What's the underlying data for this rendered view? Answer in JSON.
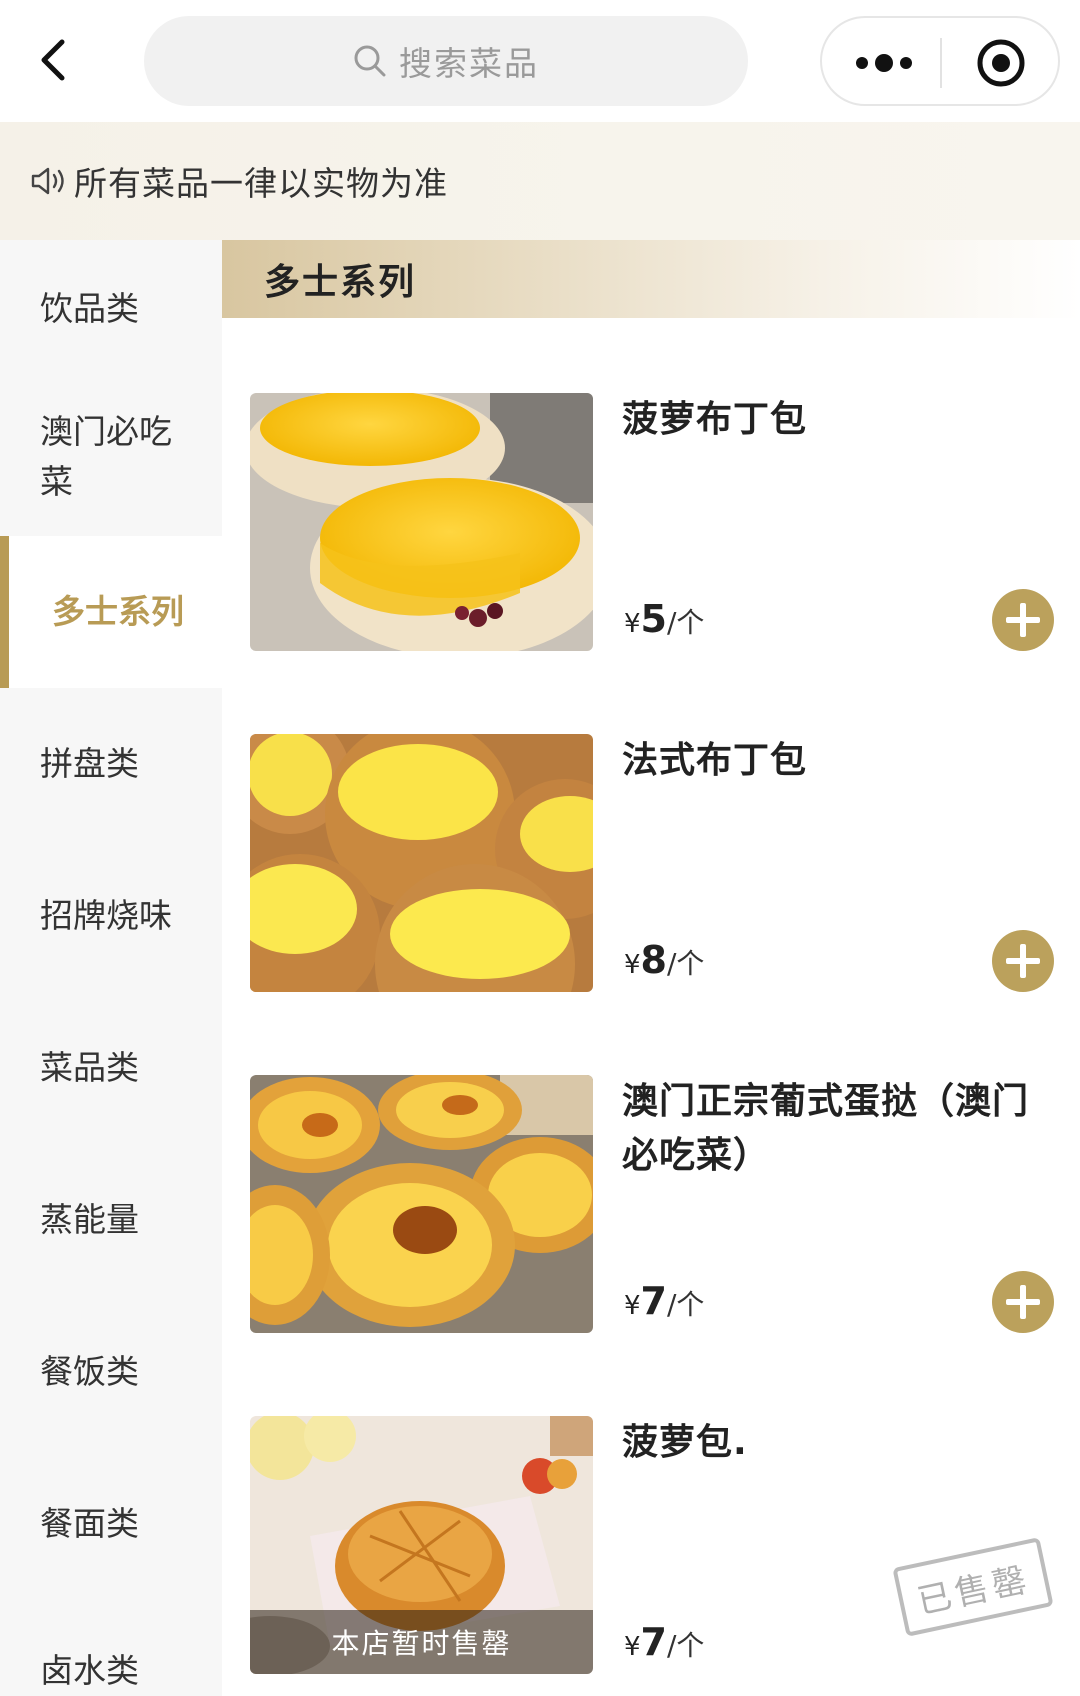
{
  "header": {
    "search_placeholder": "搜索菜品"
  },
  "notice": {
    "text": "所有菜品一律以实物为准"
  },
  "sidebar": {
    "items": [
      {
        "label": "饮品类"
      },
      {
        "label": "澳门必吃菜"
      },
      {
        "label": "多士系列",
        "active": true
      },
      {
        "label": "拼盘类"
      },
      {
        "label": "招牌烧味"
      },
      {
        "label": "菜品类"
      },
      {
        "label": "蒸能量"
      },
      {
        "label": "餐饭类"
      },
      {
        "label": "餐面类"
      },
      {
        "label": "卤水类"
      }
    ]
  },
  "category": {
    "title": "多士系列"
  },
  "products": [
    {
      "name": "菠萝布丁包",
      "currency": "¥",
      "price": "5",
      "unit": "/个",
      "sold_out": false
    },
    {
      "name": "法式布丁包",
      "currency": "¥",
      "price": "8",
      "unit": "/个",
      "sold_out": false
    },
    {
      "name": "澳门正宗葡式蛋挞（澳门必吃菜）",
      "currency": "¥",
      "price": "7",
      "unit": "/个",
      "sold_out": false
    },
    {
      "name": "菠萝包.",
      "currency": "¥",
      "price": "7",
      "unit": "/个",
      "sold_out": true,
      "sold_out_label": "本店暂时售罄",
      "stamp_label": "已售罄"
    }
  ],
  "colors": {
    "accent": "#b89b55",
    "add_button": "#bba15c",
    "notice_bg": "#f5f1e8",
    "sidebar_bg": "#f7f7f7"
  },
  "icons": {
    "back": "chevron-left-icon",
    "search": "search-icon",
    "more": "more-dots-icon",
    "target": "target-icon",
    "notice": "speaker-icon",
    "add": "plus-circle-icon"
  }
}
